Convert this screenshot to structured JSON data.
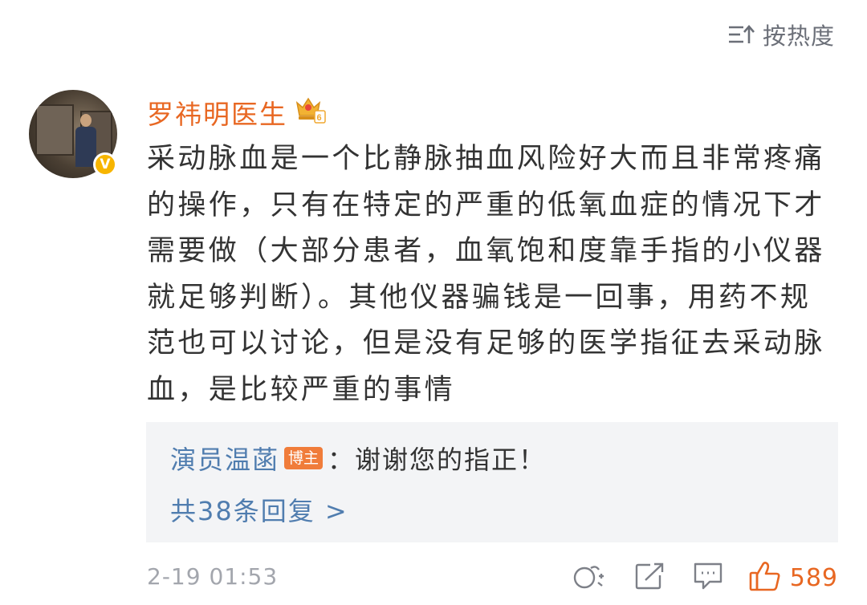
{
  "sort": {
    "label": "按热度",
    "icon": "sort-icon"
  },
  "comment": {
    "author": "罗祎明医生",
    "author_badge_icon": "crown-level-badge-icon",
    "author_level": "6",
    "verified_mark": "V",
    "text": "采动脉血是一个比静脉抽血风险好大而且非常疼痛的操作，只有在特定的严重的低氧血症的情况下才需要做（大部分患者，血氧饱和度靠手指的小仪器就足够判断）。其他仪器骗钱是一回事，用药不规范也可以讨论，但是没有足够的医学指征去采动脉血，是比较严重的事情",
    "timestamp": "2-19 01:53",
    "like_count": "589"
  },
  "reply": {
    "author": "演员温菡",
    "tag": "博主",
    "text": "：谢谢您的指正！",
    "more_label": "共38条回复 >"
  },
  "colors": {
    "username": "#e86722",
    "link": "#507daf",
    "body_text": "#333333",
    "meta": "#a3a6ad",
    "reply_bg": "#f3f4f6",
    "like": "#e86722"
  }
}
